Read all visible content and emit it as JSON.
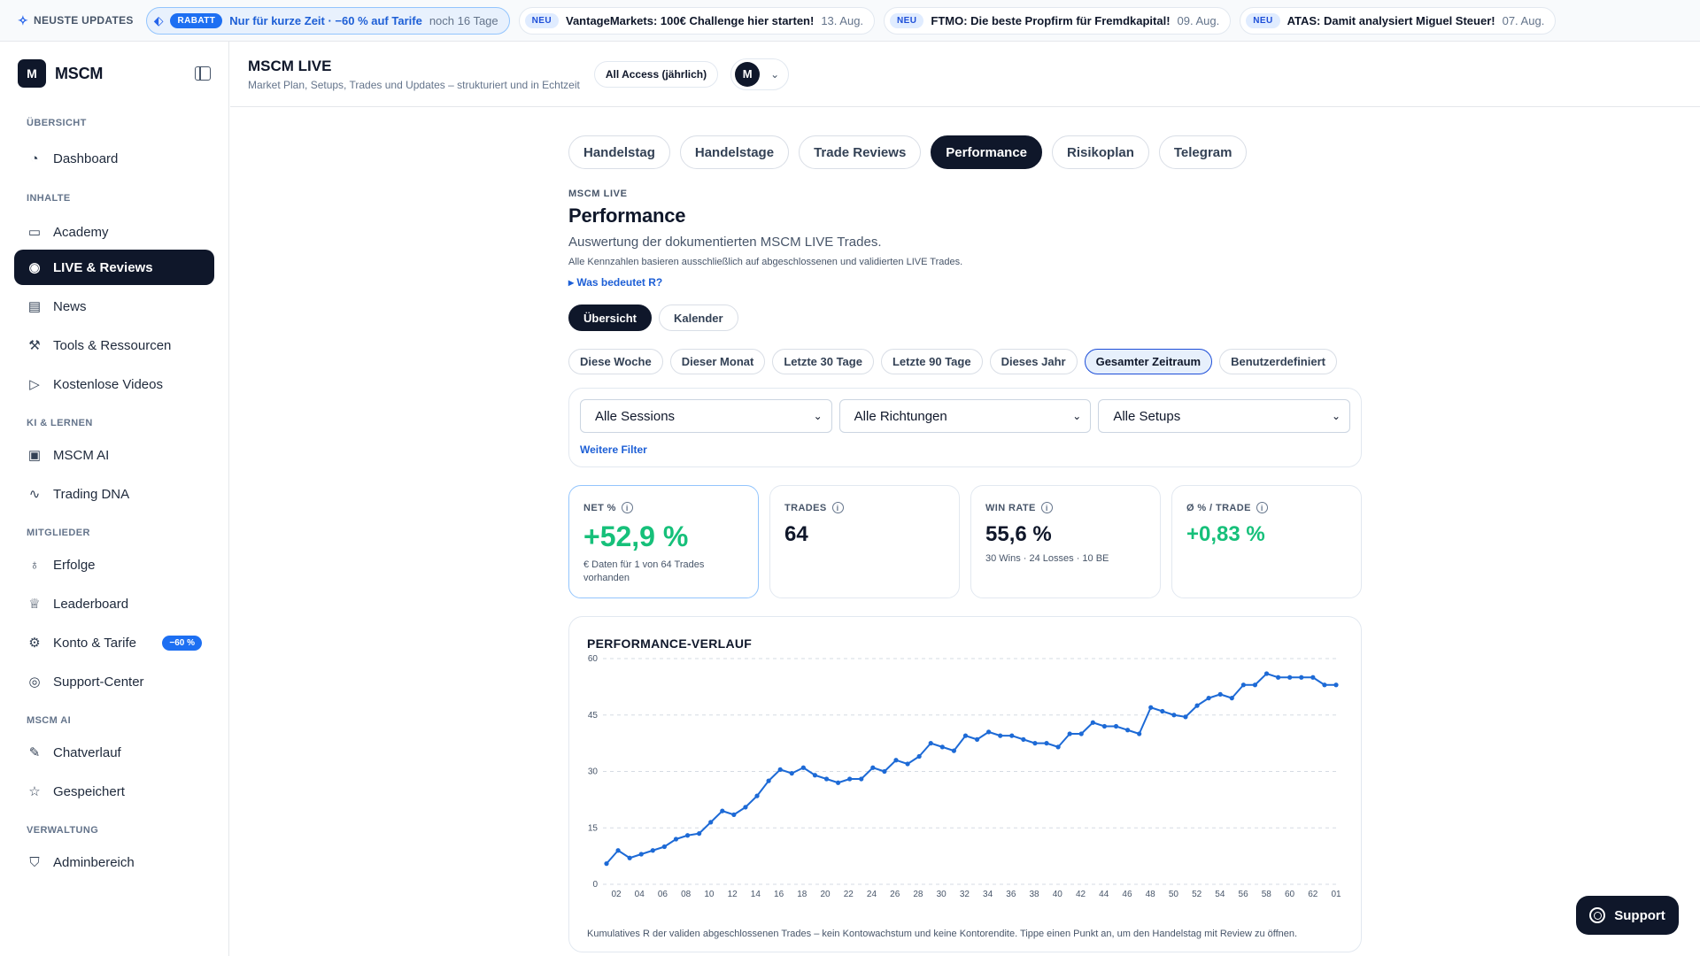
{
  "topbar": {
    "label": "NEUSTE UPDATES",
    "promo": {
      "badge": "RABATT",
      "text": "Nur für kurze Zeit · −60 % auf Tarife",
      "date": "noch 16 Tage"
    },
    "news": [
      {
        "badge": "NEU",
        "text": "VantageMarkets: 100€ Challenge hier starten!",
        "date": "13. Aug."
      },
      {
        "badge": "NEU",
        "text": "FTMO: Die beste Propfirm für Fremdkapital!",
        "date": "09. Aug."
      },
      {
        "badge": "NEU",
        "text": "ATAS: Damit analysiert Miguel Steuer!",
        "date": "07. Aug."
      }
    ]
  },
  "sidebar": {
    "brand": "MSCM",
    "logo": "M",
    "sections": {
      "overview": "ÜBERSICHT",
      "content": "INHALTE",
      "ai": "KI & LERNEN",
      "members": "MITGLIEDER",
      "mscm_ai": "MSCM AI",
      "admin": "VERWALTUNG"
    },
    "items": {
      "dashboard": "Dashboard",
      "academy": "Academy",
      "live": "LIVE & Reviews",
      "news": "News",
      "tools": "Tools & Ressourcen",
      "videos": "Kostenlose Videos",
      "mscm_ai": "MSCM AI",
      "dna": "Trading DNA",
      "erfolge": "Erfolge",
      "leaderboard": "Leaderboard",
      "konto": "Konto & Tarife",
      "konto_badge": "−60 %",
      "support": "Support-Center",
      "chat": "Chatverlauf",
      "saved": "Gespeichert",
      "admin": "Adminbereich"
    }
  },
  "header": {
    "title": "MSCM LIVE",
    "subtitle": "Market Plan, Setups, Trades und Updates – strukturiert und in Echtzeit",
    "plan": "All Access (jährlich)",
    "avatar": "M"
  },
  "tabs": [
    "Handelstag",
    "Handelstage",
    "Trade Reviews",
    "Performance",
    "Risikoplan",
    "Telegram"
  ],
  "page": {
    "eyebrow": "MSCM LIVE",
    "title": "Performance",
    "description": "Auswertung der dokumentierten MSCM LIVE Trades.",
    "note": "Alle Kennzahlen basieren ausschließlich auf abgeschlossenen und validierten LIVE Trades.",
    "r_link": "▸ Was bedeutet R?"
  },
  "view_toggle": [
    "Übersicht",
    "Kalender"
  ],
  "ranges": [
    "Diese Woche",
    "Dieser Monat",
    "Letzte 30 Tage",
    "Letzte 90 Tage",
    "Dieses Jahr",
    "Gesamter Zeitraum",
    "Benutzerdefiniert"
  ],
  "filters": {
    "sessions": "Alle Sessions",
    "directions": "Alle Richtungen",
    "setups": "Alle Setups",
    "more": "Weitere Filter"
  },
  "kpis": {
    "net": {
      "label": "NET %",
      "value": "+52,9 %",
      "sub": "€ Daten für 1 von 64 Trades vorhanden"
    },
    "trades": {
      "label": "TRADES",
      "value": "64"
    },
    "winrate": {
      "label": "WIN RATE",
      "value": "55,6 %",
      "sub": "30 Wins · 24 Losses · 10 BE"
    },
    "avg": {
      "label": "Ø % / TRADE",
      "value": "+0,83 %"
    }
  },
  "chart": {
    "title": "PERFORMANCE-VERLAUF",
    "caption": "Kumulatives R der validen abgeschlossenen Trades – kein Kontowachstum und keine Kontorendite. Tippe einen Punkt an, um den Handelstag mit Review zu öffnen."
  },
  "support_button": "Support",
  "chart_data": {
    "type": "line",
    "title": "PERFORMANCE-VERLAUF",
    "ylim": [
      0,
      60
    ],
    "yticks": [
      0,
      15,
      30,
      45,
      60
    ],
    "xticks": [
      "02",
      "04",
      "06",
      "08",
      "10",
      "12",
      "14",
      "16",
      "18",
      "20",
      "22",
      "24",
      "26",
      "28",
      "30",
      "32",
      "34",
      "36",
      "38",
      "40",
      "42",
      "44",
      "46",
      "48",
      "50",
      "52",
      "54",
      "56",
      "58",
      "60",
      "62",
      "01"
    ],
    "grid": true,
    "color": "#1d6ad6",
    "values": [
      5.5,
      9,
      7,
      8,
      9,
      10,
      12,
      13,
      13.5,
      16.5,
      19.5,
      18.5,
      20.5,
      23.5,
      27.5,
      30.5,
      29.5,
      31,
      29,
      28,
      27,
      28,
      28,
      31,
      30,
      33,
      32,
      34,
      37.5,
      36.5,
      35.5,
      39.5,
      38.5,
      40.5,
      39.5,
      39.5,
      38.5,
      37.5,
      37.5,
      36.5,
      40,
      40,
      43,
      42,
      42,
      41,
      40,
      47,
      46,
      45,
      44.5,
      47.5,
      49.5,
      50.5,
      49.5,
      53,
      53,
      56,
      55,
      55,
      55,
      55,
      53,
      53
    ]
  },
  "colors": {
    "accent": "#1d6ff2",
    "dark": "#0f172a",
    "positive": "#16c07a"
  }
}
